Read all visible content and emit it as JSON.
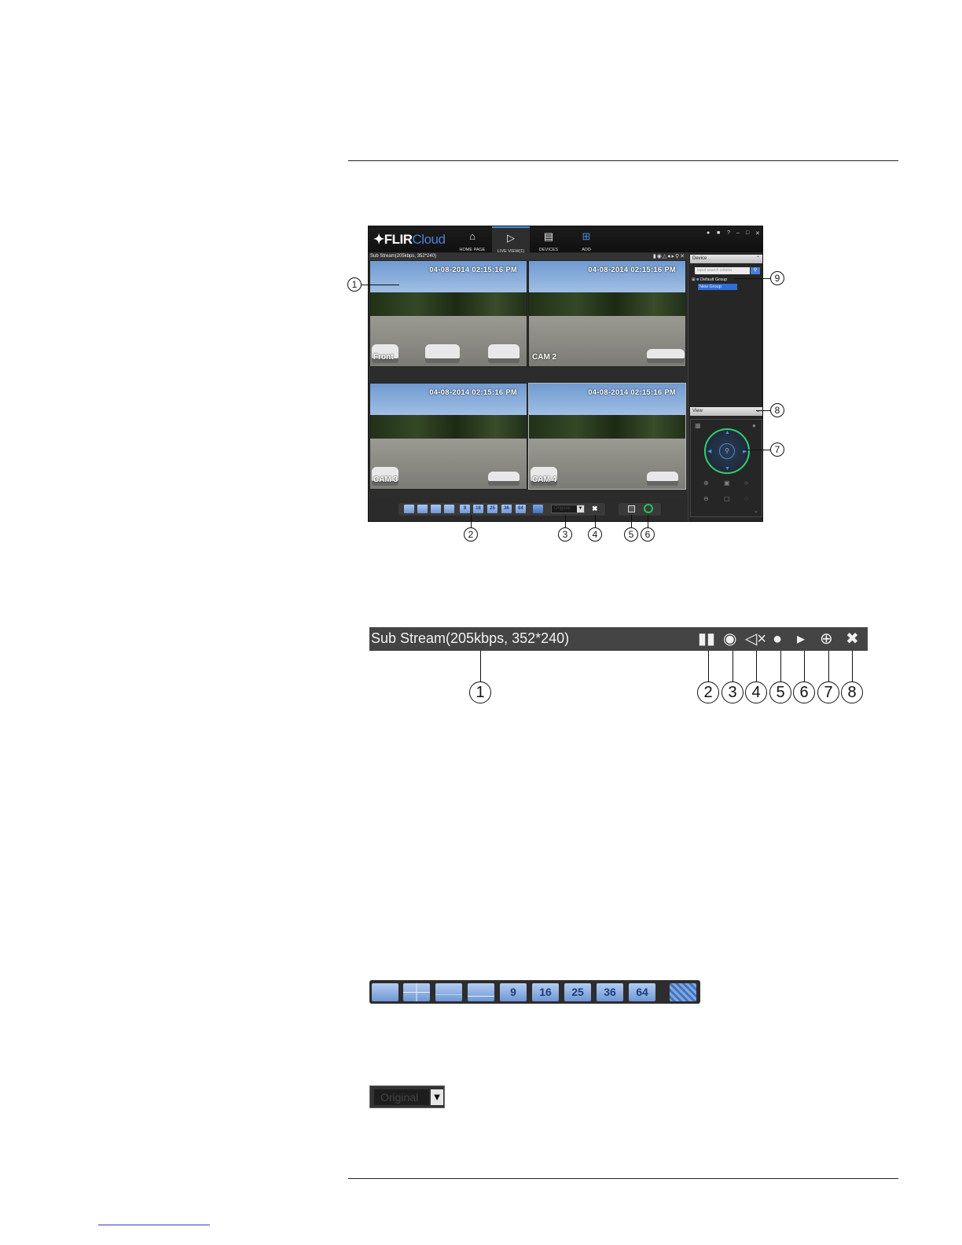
{
  "app": {
    "logo_main": "FLIR",
    "logo_sub": "Cloud",
    "nav": [
      {
        "label": "HOME PAGE",
        "icon": "home-icon"
      },
      {
        "label": "LIVE VIEW(1)",
        "icon": "camera-icon"
      },
      {
        "label": "DEVICES",
        "icon": "devices-icon"
      },
      {
        "label": "ADD",
        "icon": "add-icon"
      }
    ],
    "stream_info": "Sub Stream(205kbps, 352*240)",
    "cameras": [
      {
        "name": "Front",
        "timestamp": "04-08-2014 02:15:16 PM"
      },
      {
        "name": "CAM 2",
        "timestamp": "04-08-2014 02:15:16 PM"
      },
      {
        "name": "CAM 3",
        "timestamp": "04-08-2014 02:15:16 PM"
      },
      {
        "name": "CAM 4",
        "timestamp": "04-08-2014 02:15:16 PM"
      }
    ],
    "layout_buttons": [
      "9",
      "16",
      "25",
      "36",
      "64"
    ],
    "aspect_value": "Original",
    "device_panel": {
      "header": "Device",
      "search_placeholder": "Input search criteria",
      "groups": [
        "Default Group",
        "New Group"
      ]
    },
    "view_panel_header": "View"
  },
  "callouts_top": [
    "1",
    "2",
    "3",
    "4",
    "5",
    "6",
    "7",
    "8",
    "9"
  ],
  "streambar_zoom": {
    "text": "Sub Stream(205kbps, 352*240)",
    "callouts": [
      "1",
      "2",
      "3",
      "4",
      "5",
      "6",
      "7",
      "8"
    ]
  },
  "layout_zoom_buttons": [
    "9",
    "16",
    "25",
    "36",
    "64"
  ],
  "aspect_zoom_value": "Original"
}
